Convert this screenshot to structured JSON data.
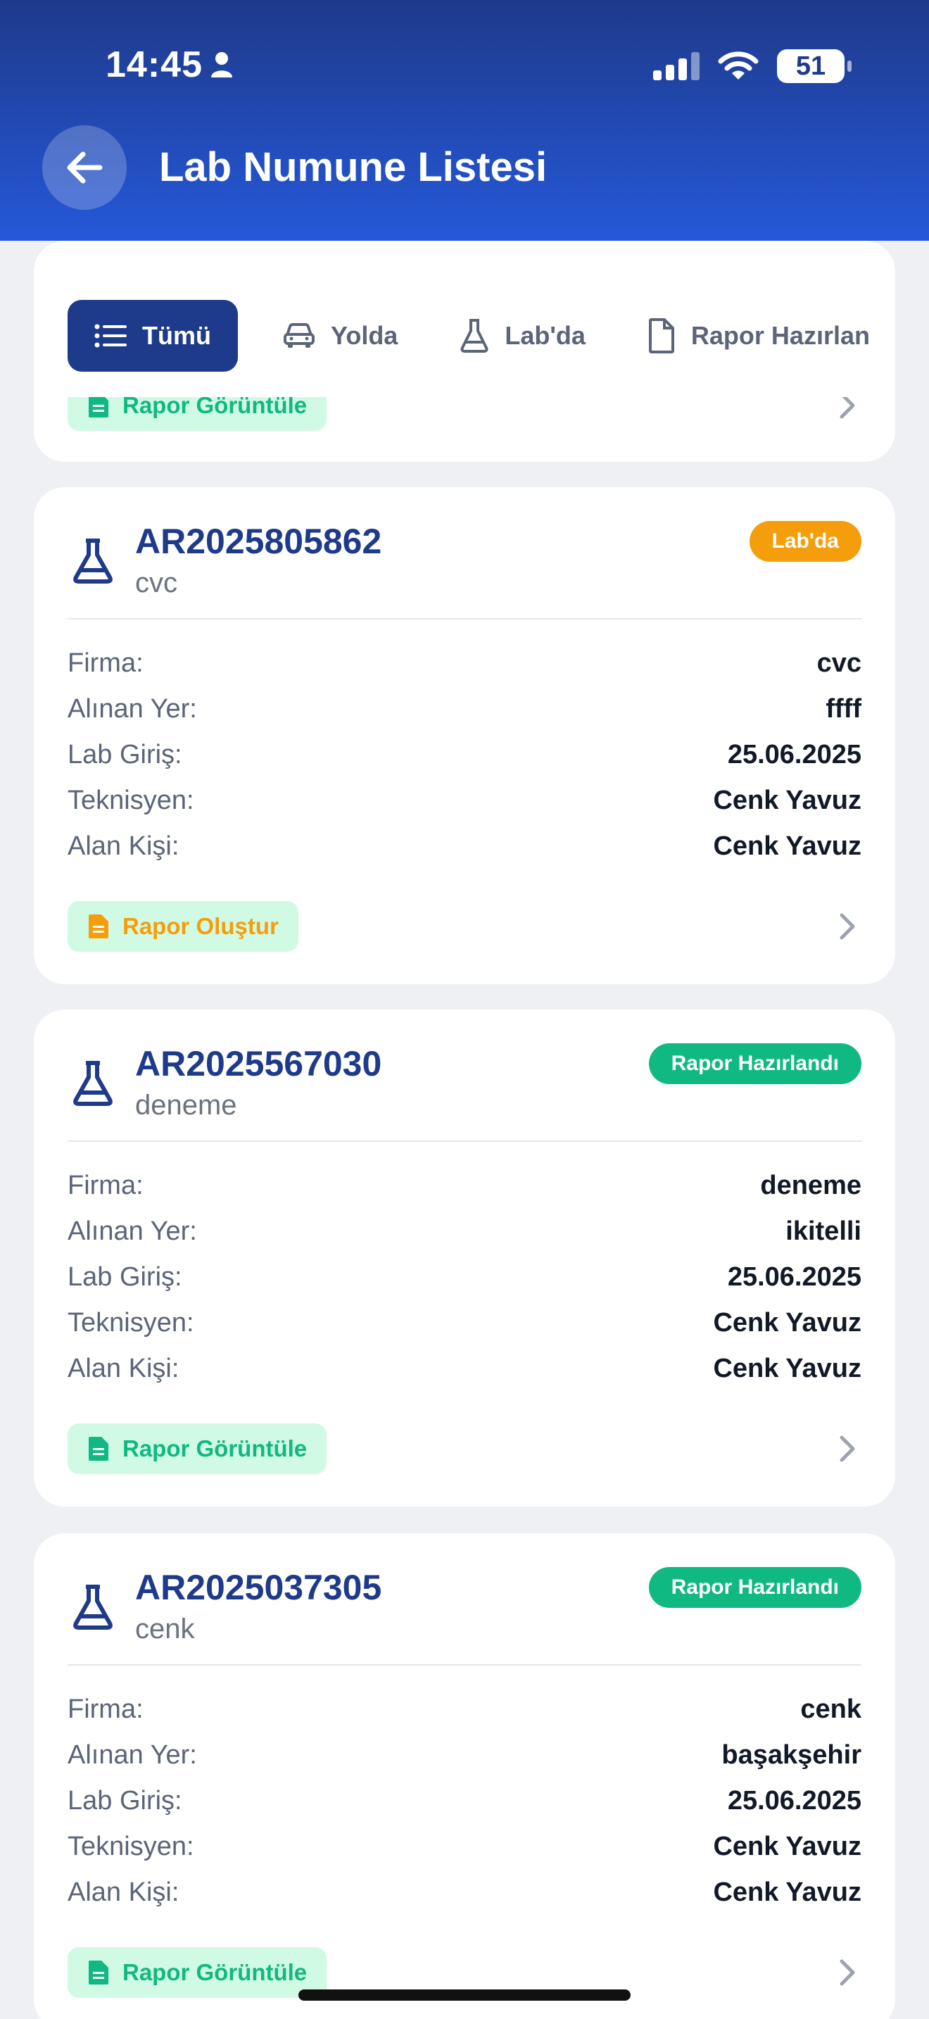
{
  "status": {
    "time": "14:45",
    "battery": "51"
  },
  "header": {
    "title": "Lab Numune Listesi"
  },
  "tabs": [
    {
      "label": "Tümü"
    },
    {
      "label": "Yolda"
    },
    {
      "label": "Lab'da"
    },
    {
      "label": "Rapor Hazırlan"
    }
  ],
  "partial_card": {
    "report_label": "Rapor Görüntüle"
  },
  "field_labels": {
    "firma": "Firma:",
    "alinan_yer": "Alınan Yer:",
    "lab_giris": "Lab Giriş:",
    "teknisyen": "Teknisyen:",
    "alan_kisi": "Alan Kişi:"
  },
  "cards": [
    {
      "code": "AR2025805862",
      "sub": "cvc",
      "status": "Lab'da",
      "firma": "cvc",
      "alinan_yer": "ffff",
      "lab_giris": "25.06.2025",
      "teknisyen": "Cenk Yavuz",
      "alan_kisi": "Cenk Yavuz",
      "action": "Rapor Oluştur"
    },
    {
      "code": "AR2025567030",
      "sub": "deneme",
      "status": "Rapor Hazırlandı",
      "firma": "deneme",
      "alinan_yer": "ikitelli",
      "lab_giris": "25.06.2025",
      "teknisyen": "Cenk Yavuz",
      "alan_kisi": "Cenk Yavuz",
      "action": "Rapor Görüntüle"
    },
    {
      "code": "AR2025037305",
      "sub": "cenk",
      "status": "Rapor Hazırlandı",
      "firma": "cenk",
      "alinan_yer": "başakşehir",
      "lab_giris": "25.06.2025",
      "teknisyen": "Cenk Yavuz",
      "alan_kisi": "Cenk Yavuz",
      "action": "Rapor Görüntüle"
    }
  ],
  "colors": {
    "primary": "#1e3a8a",
    "green": "#10b981",
    "orange": "#f59e0b"
  }
}
